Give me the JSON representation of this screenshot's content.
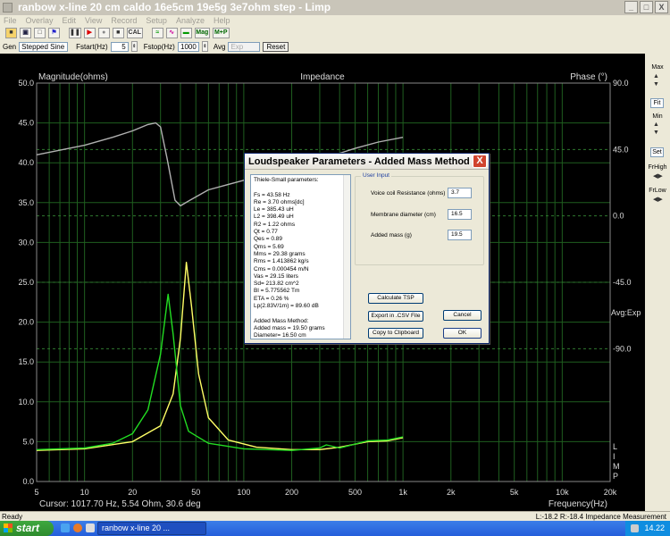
{
  "window": {
    "title": "ranbow x-line 20 cm caldo 16e5cm 19e5g 3e7ohm step - Limp",
    "controls": [
      "_",
      "□",
      "X"
    ]
  },
  "menu": [
    "File",
    "Overlay",
    "Edit",
    "View",
    "Record",
    "Setup",
    "Analyze",
    "Help"
  ],
  "toolbar": {
    "cal_label": "CAL",
    "mag_label": "Mag",
    "mp_label": "M+P"
  },
  "gen_bar": {
    "gen_label": "Gen",
    "gen_value": "Stepped Sine",
    "fstart_label": "Fstart(Hz)",
    "fstart_value": "5",
    "fstop_label": "Fstop(Hz)",
    "fstop_value": "1000",
    "avg_label": "Avg",
    "avg_value": "Exp",
    "reset_label": "Reset"
  },
  "plot": {
    "left_title": "Magnitude(ohms)",
    "center_title": "Impedance",
    "right_title": "Phase (°)",
    "avg_text": "Avg:Exp",
    "limp_text": [
      "L",
      "I",
      "M",
      "P"
    ],
    "cursor_text": "Cursor: 1017.70 Hz, 5.54 Ohm, 30.6 deg",
    "x_axis_label": "Frequency(Hz)"
  },
  "chart_data": {
    "type": "line",
    "title": "Impedance",
    "xlabel": "Frequency(Hz)",
    "ylabel": "Magnitude(ohms)",
    "y2label": "Phase (°)",
    "xscale": "log",
    "xlim": [
      5,
      20000
    ],
    "ylim": [
      0,
      50
    ],
    "y2lim": [
      -180,
      90
    ],
    "x_ticks": [
      "5",
      "10",
      "20",
      "50",
      "100",
      "200",
      "500",
      "1k",
      "2k",
      "5k",
      "10k",
      "20k"
    ],
    "y_ticks": [
      "0.0",
      "5.0",
      "10.0",
      "15.0",
      "20.0",
      "25.0",
      "30.0",
      "35.0",
      "40.0",
      "45.0",
      "50.0"
    ],
    "y2_ticks": [
      "90.0",
      "45.0",
      "0.0",
      "-45.0",
      "-90.0"
    ],
    "grid": true,
    "series": [
      {
        "color": "#ffff66",
        "x": [
          5,
          10,
          20,
          30,
          36,
          40,
          43.6,
          47,
          52,
          60,
          80,
          120,
          200,
          300,
          400,
          600,
          800,
          1000
        ],
        "y": [
          3.9,
          4.1,
          5.0,
          7.0,
          11.0,
          18.0,
          27.5,
          22.0,
          13.5,
          8.0,
          5.2,
          4.3,
          4.0,
          4.0,
          4.3,
          5.0,
          5.1,
          5.5
        ]
      },
      {
        "color": "#22dd22",
        "x": [
          5,
          10,
          15,
          20,
          25,
          30,
          33.5,
          36,
          40,
          45,
          60,
          100,
          200,
          300,
          330,
          400,
          600,
          800,
          1000
        ],
        "y": [
          4.0,
          4.2,
          4.8,
          6.0,
          9.0,
          16.0,
          23.5,
          18.5,
          9.5,
          6.3,
          4.8,
          4.1,
          3.9,
          4.2,
          4.6,
          4.2,
          5.1,
          5.2,
          5.6
        ]
      },
      {
        "color": "#b0b0b0",
        "x": [
          5,
          10,
          15,
          20,
          25,
          28,
          30,
          33,
          37,
          40,
          45,
          60,
          100,
          200,
          300,
          500,
          700,
          1000
        ],
        "y": [
          41,
          42.2,
          43.2,
          44.0,
          44.8,
          45.0,
          44.5,
          40.5,
          35.3,
          34.6,
          35.2,
          36.6,
          37.8,
          39.3,
          40.4,
          41.8,
          42.6,
          43.2
        ]
      }
    ]
  },
  "right_panel": {
    "max_label": "Max",
    "fit_label": "Fit",
    "min_label": "Min",
    "set_label": "Set",
    "frhigh_label": "FrHigh",
    "frlow_label": "FrLow"
  },
  "dialog": {
    "title": "Loudspeaker Parameters - Added Mass Method",
    "close_label": "X",
    "ts_lines": [
      "Thiele-Small parameters:",
      "",
      "Fs  = 43.58 Hz",
      "Re  = 3.70 ohms[dc]",
      "Le  = 385.43 uH",
      "L2  = 398.49 uH",
      "R2  = 1.22 ohms",
      "Qt  = 0.77",
      "Qes = 0.89",
      "Qms = 5.69",
      "Mms = 29.38 grams",
      "Rms = 1.413862 kg/s",
      "Cms = 0.000454 m/N",
      "Vas = 29.15 liters",
      "Sd= 213.82 cm^2",
      "Bl  = 5.775562 Tm",
      "ETA = 0.26 %",
      "Lp(2.83V/1m) = 89.60 dB",
      "",
      "Added Mass Method:",
      "Added mass = 19.50 grams",
      "Diameter= 16.50 cm"
    ],
    "user_input_label": "User Input",
    "fields": [
      {
        "label": "Voice coil Resistance (ohms)",
        "value": "3.7"
      },
      {
        "label": "Membrane diameter (cm)",
        "value": "16.5"
      },
      {
        "label": "Added mass (g)",
        "value": "19.5"
      }
    ],
    "calculate_label": "Calculate TSP",
    "export_label": "Export in .CSV File",
    "clipboard_label": "Copy to Clipboard",
    "cancel_label": "Cancel",
    "ok_label": "OK"
  },
  "status": {
    "left": "Ready",
    "right": "L:-18.2  R:-18.4   Impedance Measurement"
  },
  "taskbar": {
    "start_label": "start",
    "task_label": "ranbow x-line 20 ...",
    "clock": "14.22"
  }
}
